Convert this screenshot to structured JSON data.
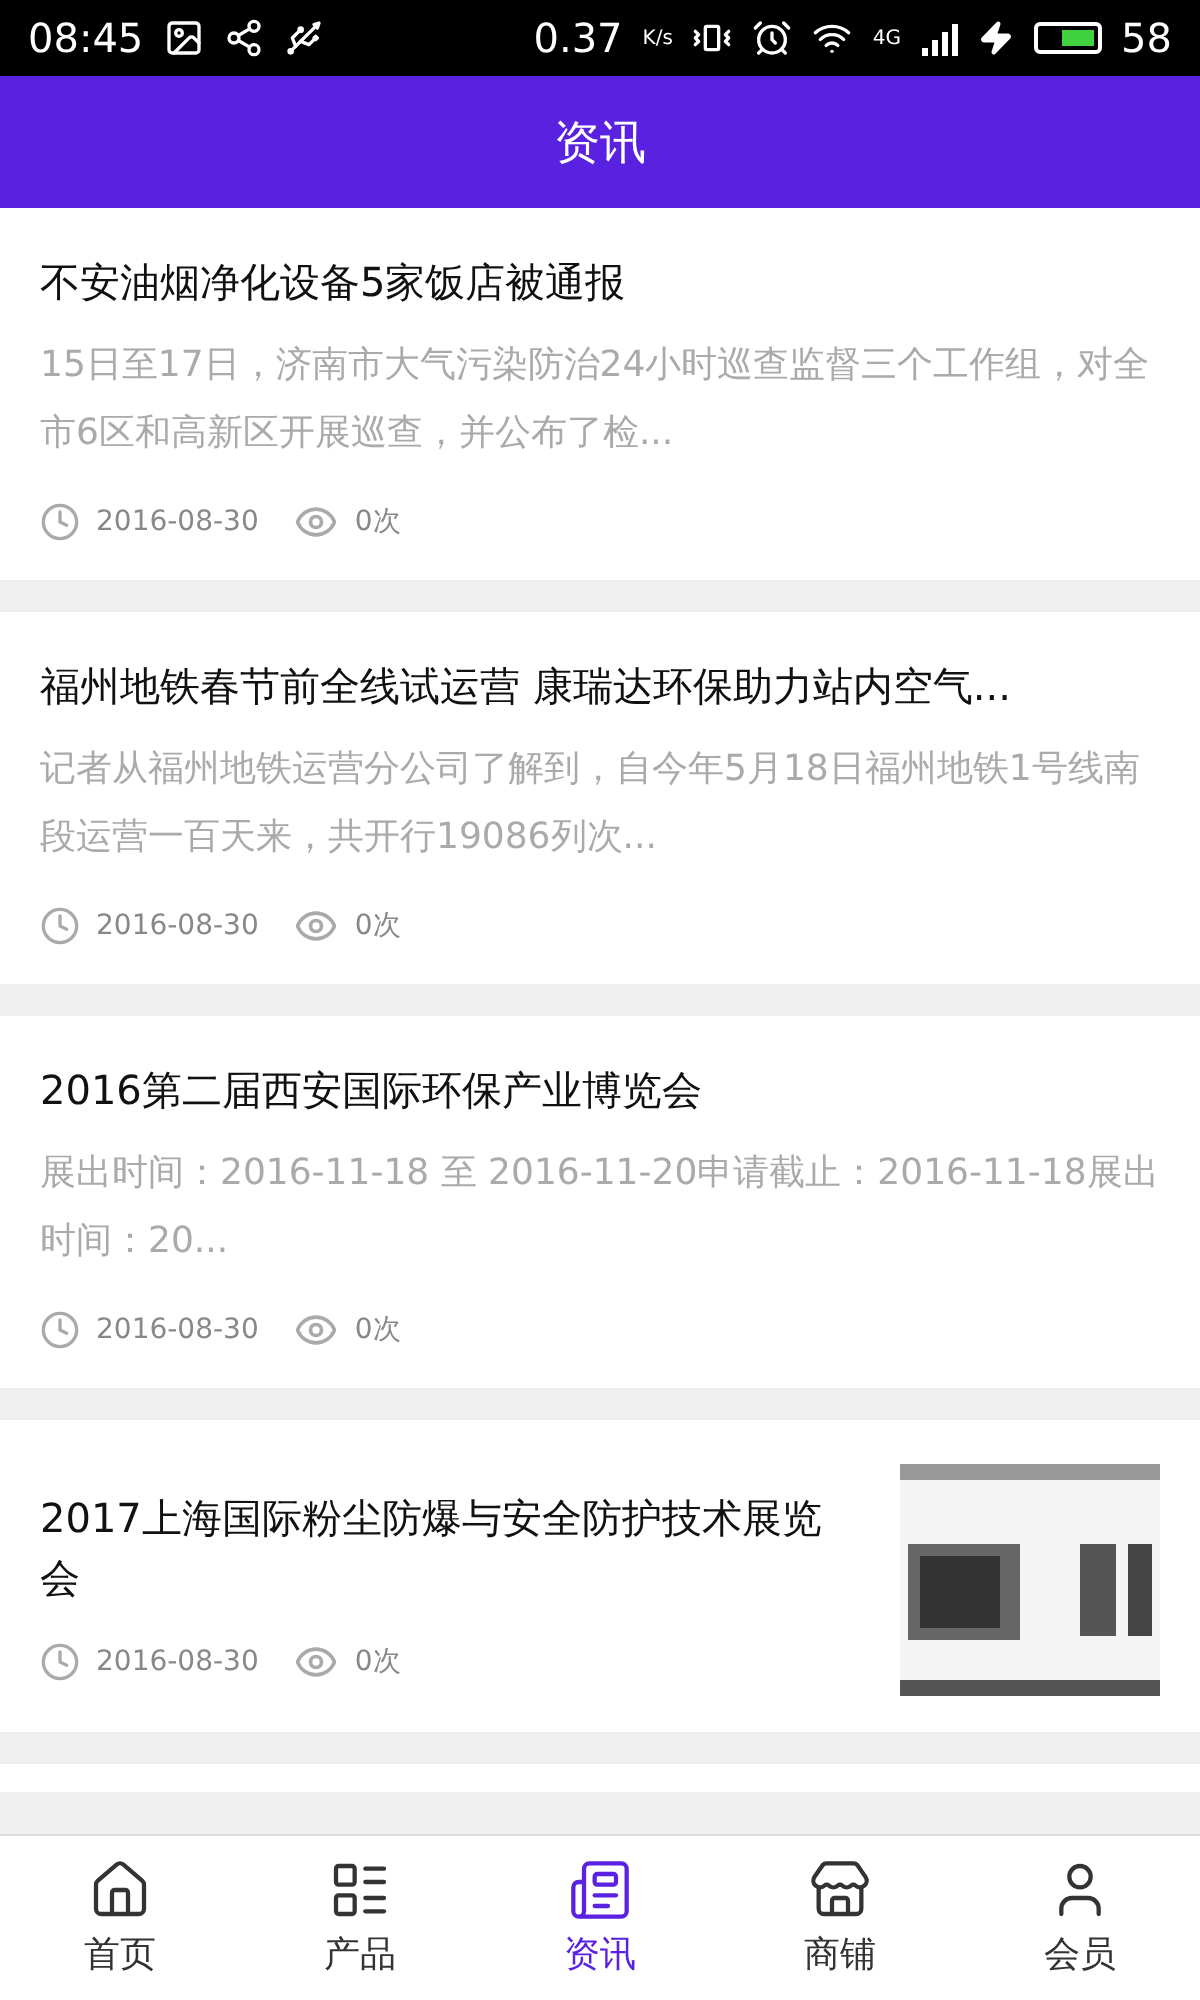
{
  "status_bar": {
    "time": "08:45",
    "speed": "0.37",
    "speed_unit": "K/s",
    "network": "4G",
    "battery_text": "58"
  },
  "header": {
    "title": "资讯"
  },
  "articles": [
    {
      "title": "不安油烟净化设备5家饭店被通报",
      "summary": "15日至17日，济南市大气污染防治24小时巡查监督三个工作组，对全市6区和高新区开展巡查，并公布了检...",
      "date": "2016-08-30",
      "views": "0次"
    },
    {
      "title": "福州地铁春节前全线试运营 康瑞达环保助力站内空气...",
      "summary": "记者从福州地铁运营分公司了解到，自今年5月18日福州地铁1号线南段运营一百天来，共开行19086列次...",
      "date": "2016-08-30",
      "views": "0次"
    },
    {
      "title": "2016第二届西安国际环保产业博览会",
      "summary": "展出时间：2016-11-18 至 2016-11-20申请截止：2016-11-18展出时间：20...",
      "date": "2016-08-30",
      "views": "0次"
    },
    {
      "title": "2017上海国际粉尘防爆与安全防护技术展览会",
      "date": "2016-08-30",
      "views": "0次"
    }
  ],
  "tab_bar": [
    {
      "label": "首页",
      "selected": false
    },
    {
      "label": "产品",
      "selected": false
    },
    {
      "label": "资讯",
      "selected": true
    },
    {
      "label": "商铺",
      "selected": false
    },
    {
      "label": "会员",
      "selected": false
    }
  ]
}
